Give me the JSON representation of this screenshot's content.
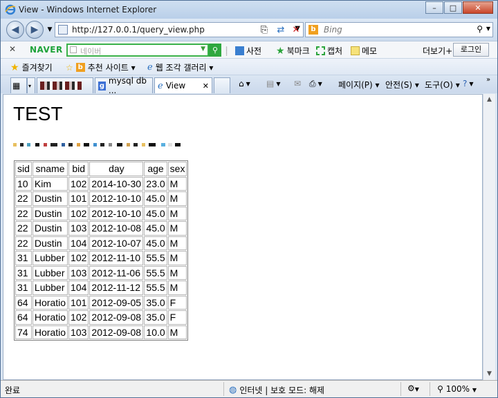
{
  "window": {
    "title": "View - Windows Internet Explorer",
    "minimize": "–",
    "maximize": "□",
    "close": "✕"
  },
  "address": {
    "url": "http://127.0.0.1/query_view.php"
  },
  "search": {
    "placeholder": "Bing"
  },
  "naver": {
    "close": "✕",
    "logo": "NAVER",
    "placeholder": "네이버",
    "items": [
      "사전",
      "북마크",
      "캡처",
      "메모"
    ],
    "more": "더보기+",
    "login": "로그인"
  },
  "favorites": {
    "label": "즐겨찾기",
    "items": [
      "추천 사이트 ▾",
      "웹 조각 갤러리 ▾"
    ]
  },
  "tabs": [
    {
      "label": "mysql db ..."
    },
    {
      "label": "View"
    }
  ],
  "commands": [
    "페이지(P) ▾",
    "안전(S) ▾",
    "도구(O) ▾"
  ],
  "page": {
    "title": "TEST"
  },
  "table": {
    "headers": [
      "sid",
      "sname",
      "bid",
      "day",
      "age",
      "sex"
    ],
    "rows": [
      [
        "10",
        "Kim",
        "102",
        "2014-10-30",
        "23.0",
        "M"
      ],
      [
        "22",
        "Dustin",
        "101",
        "2012-10-10",
        "45.0",
        "M"
      ],
      [
        "22",
        "Dustin",
        "102",
        "2012-10-10",
        "45.0",
        "M"
      ],
      [
        "22",
        "Dustin",
        "103",
        "2012-10-08",
        "45.0",
        "M"
      ],
      [
        "22",
        "Dustin",
        "104",
        "2012-10-07",
        "45.0",
        "M"
      ],
      [
        "31",
        "Lubber",
        "102",
        "2012-11-10",
        "55.5",
        "M"
      ],
      [
        "31",
        "Lubber",
        "103",
        "2012-11-06",
        "55.5",
        "M"
      ],
      [
        "31",
        "Lubber",
        "104",
        "2012-11-12",
        "55.5",
        "M"
      ],
      [
        "64",
        "Horatio",
        "101",
        "2012-09-05",
        "35.0",
        "F"
      ],
      [
        "64",
        "Horatio",
        "102",
        "2012-09-08",
        "35.0",
        "F"
      ],
      [
        "74",
        "Horatio",
        "103",
        "2012-09-08",
        "10.0",
        "M"
      ]
    ]
  },
  "status": {
    "text": "완료",
    "zone": "인터넷 | 보호 모드: 해제",
    "zoom": "100%"
  }
}
